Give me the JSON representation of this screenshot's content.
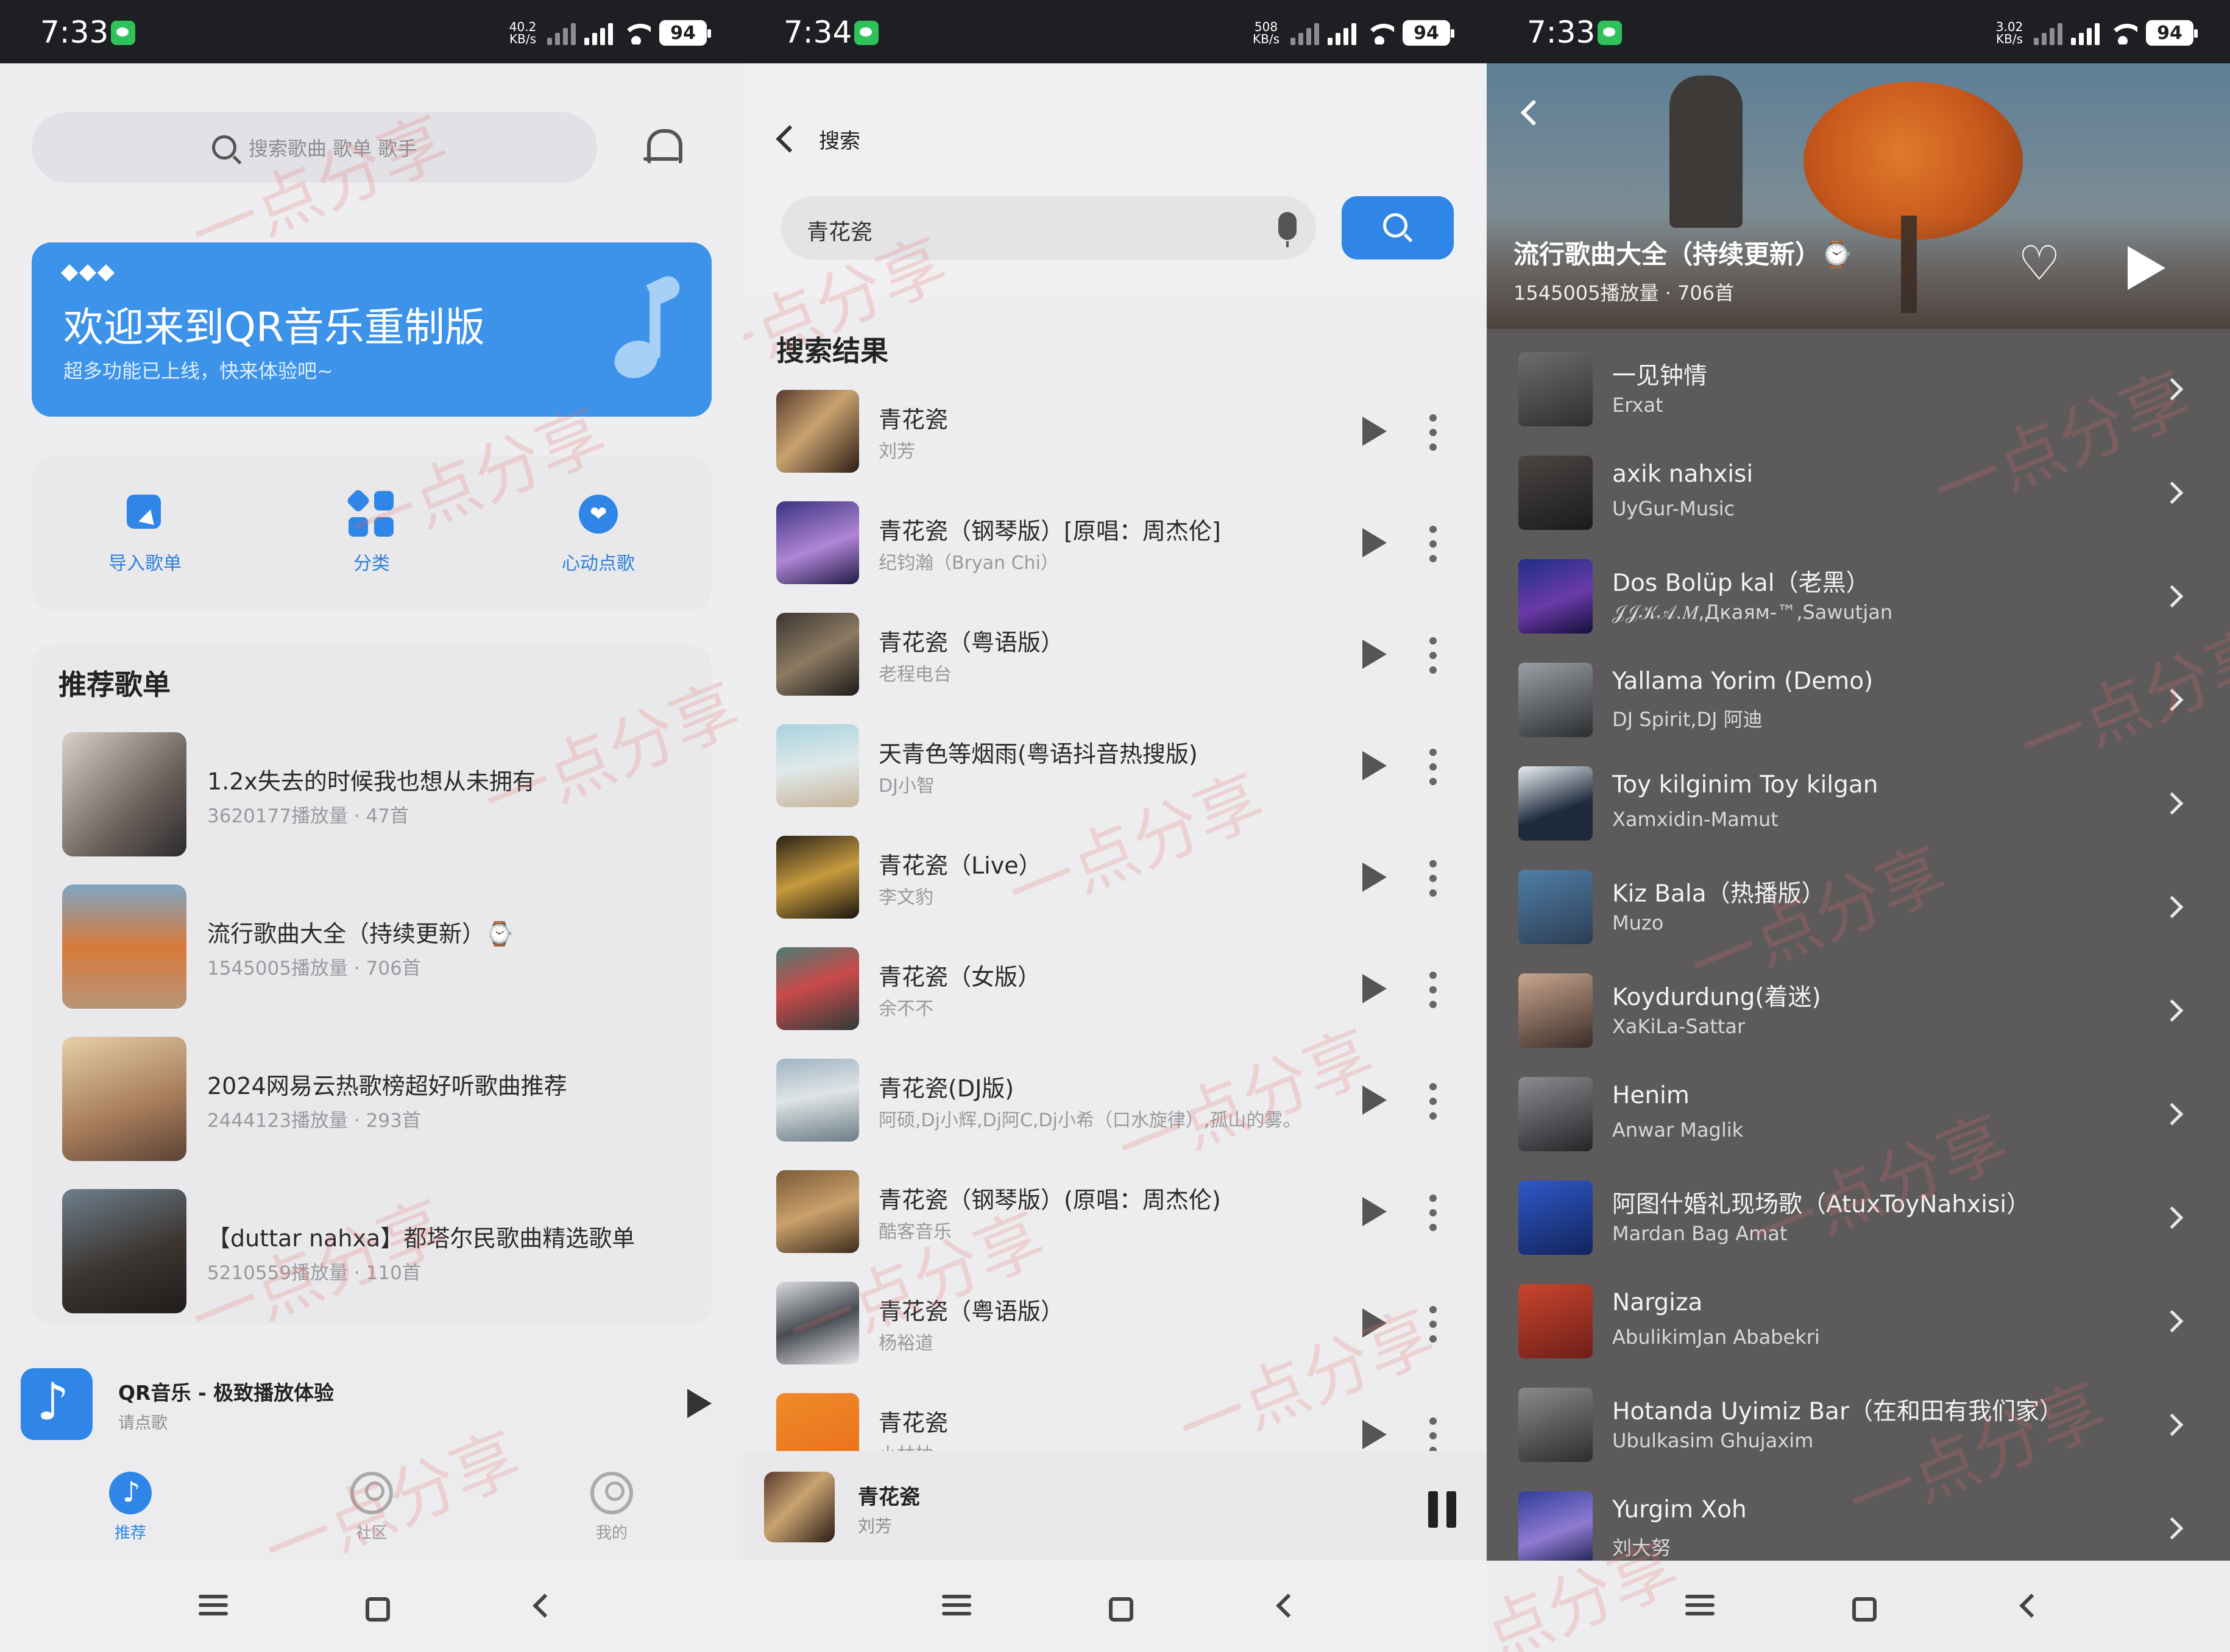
{
  "watermark": "一点分享",
  "colors": {
    "accent": "#2f86e6",
    "statusbar": "#1d1f22",
    "banner": "#3d93ea"
  },
  "screen1": {
    "status": {
      "time": "7:33",
      "speed": "40.2 KB/s",
      "battery": "94"
    },
    "search_placeholder": "搜索歌曲 歌单 歌手",
    "banner": {
      "title": "欢迎来到QR音乐重制版",
      "subtitle": "超多功能已上线，快来体验吧~"
    },
    "shortcuts": [
      {
        "label": "导入歌单",
        "icon": "import-icon"
      },
      {
        "label": "分类",
        "icon": "category-icon"
      },
      {
        "label": "心动点歌",
        "icon": "heart-icon"
      }
    ],
    "recommend_title": "推荐歌单",
    "playlists": [
      {
        "name": "1.2x失去的时候我也想从未拥有",
        "plays": "3620177播放量",
        "count": "47首"
      },
      {
        "name": "流行歌曲大全（持续更新）⌚",
        "plays": "1545005播放量",
        "count": "706首"
      },
      {
        "name": "2024网易云热歌榜超好听歌曲推荐",
        "plays": "2444123播放量",
        "count": "293首"
      },
      {
        "name": "【duttar nahxa】都塔尔民歌曲精选歌单",
        "plays": "5210559播放量",
        "count": "110首"
      }
    ],
    "mini_player": {
      "title": "QR音乐 - 极致播放体验",
      "subtitle": "请点歌"
    },
    "tabs": [
      {
        "label": "推荐"
      },
      {
        "label": "社区"
      },
      {
        "label": "我的"
      }
    ]
  },
  "screen2": {
    "status": {
      "time": "7:34",
      "speed": "508 KB/s",
      "battery": "94"
    },
    "back_label": "搜索",
    "query": "青花瓷",
    "results_title": "搜索结果",
    "songs": [
      {
        "name": "青花瓷",
        "artist": "刘芳"
      },
      {
        "name": "青花瓷（钢琴版）[原唱：周杰伦]",
        "artist": "纪钧瀚（Bryan Chi）"
      },
      {
        "name": "青花瓷（粤语版）",
        "artist": "老程电台"
      },
      {
        "name": "天青色等烟雨(粤语抖音热搜版)",
        "artist": "DJ小智"
      },
      {
        "name": "青花瓷（Live）",
        "artist": "李文豹"
      },
      {
        "name": "青花瓷（女版）",
        "artist": "余不不"
      },
      {
        "name": "青花瓷(DJ版)",
        "artist": "阿硕,Dj小辉,Dj阿C,Dj小希（口水旋律）,孤山的雾。"
      },
      {
        "name": "青花瓷（钢琴版）(原唱：周杰伦)",
        "artist": "酷客音乐"
      },
      {
        "name": "青花瓷（粤语版）",
        "artist": "杨裕道"
      },
      {
        "name": "青花瓷",
        "artist": "小林柚"
      }
    ],
    "now_playing": {
      "title": "青花瓷",
      "artist": "刘芳"
    }
  },
  "screen3": {
    "status": {
      "time": "7:33",
      "speed": "3.02 KB/s",
      "battery": "94"
    },
    "playlist_title": "流行歌曲大全（持续更新）⌚",
    "playlist_meta": "1545005播放量 · 706首",
    "tracks": [
      {
        "name": "一见钟情",
        "artist": "Erxat"
      },
      {
        "name": "axik nahxisi",
        "artist": "UyGur-Music"
      },
      {
        "name": "Dos Bolüp kal（老黑）",
        "artist": "𝒥𝒥𝒦𝒜.𝑀,Дкаям-™,Sawutjan"
      },
      {
        "name": "Yallama Yorim (Demo)",
        "artist": "DJ Spirit,DJ 阿迪"
      },
      {
        "name": "Toy kilginim Toy kilgan",
        "artist": "Xamxidin-Mamut"
      },
      {
        "name": "Kiz Bala（热播版）",
        "artist": "Muzo"
      },
      {
        "name": "Koydurdung(着迷)",
        "artist": "XaKiLa-Sattar"
      },
      {
        "name": "Henim",
        "artist": "Anwar Maglik"
      },
      {
        "name": "阿图什婚礼现场歌（AtuxToyNahxisi）",
        "artist": "Mardan Bag Amat"
      },
      {
        "name": "Nargiza",
        "artist": "AbulikimJan Ababekri"
      },
      {
        "name": "Hotanda Uyimiz Bar（在和田有我们家）",
        "artist": "Ubulkasim Ghujaxim"
      },
      {
        "name": "Yurgim Xoh",
        "artist": "刘大努"
      }
    ]
  }
}
